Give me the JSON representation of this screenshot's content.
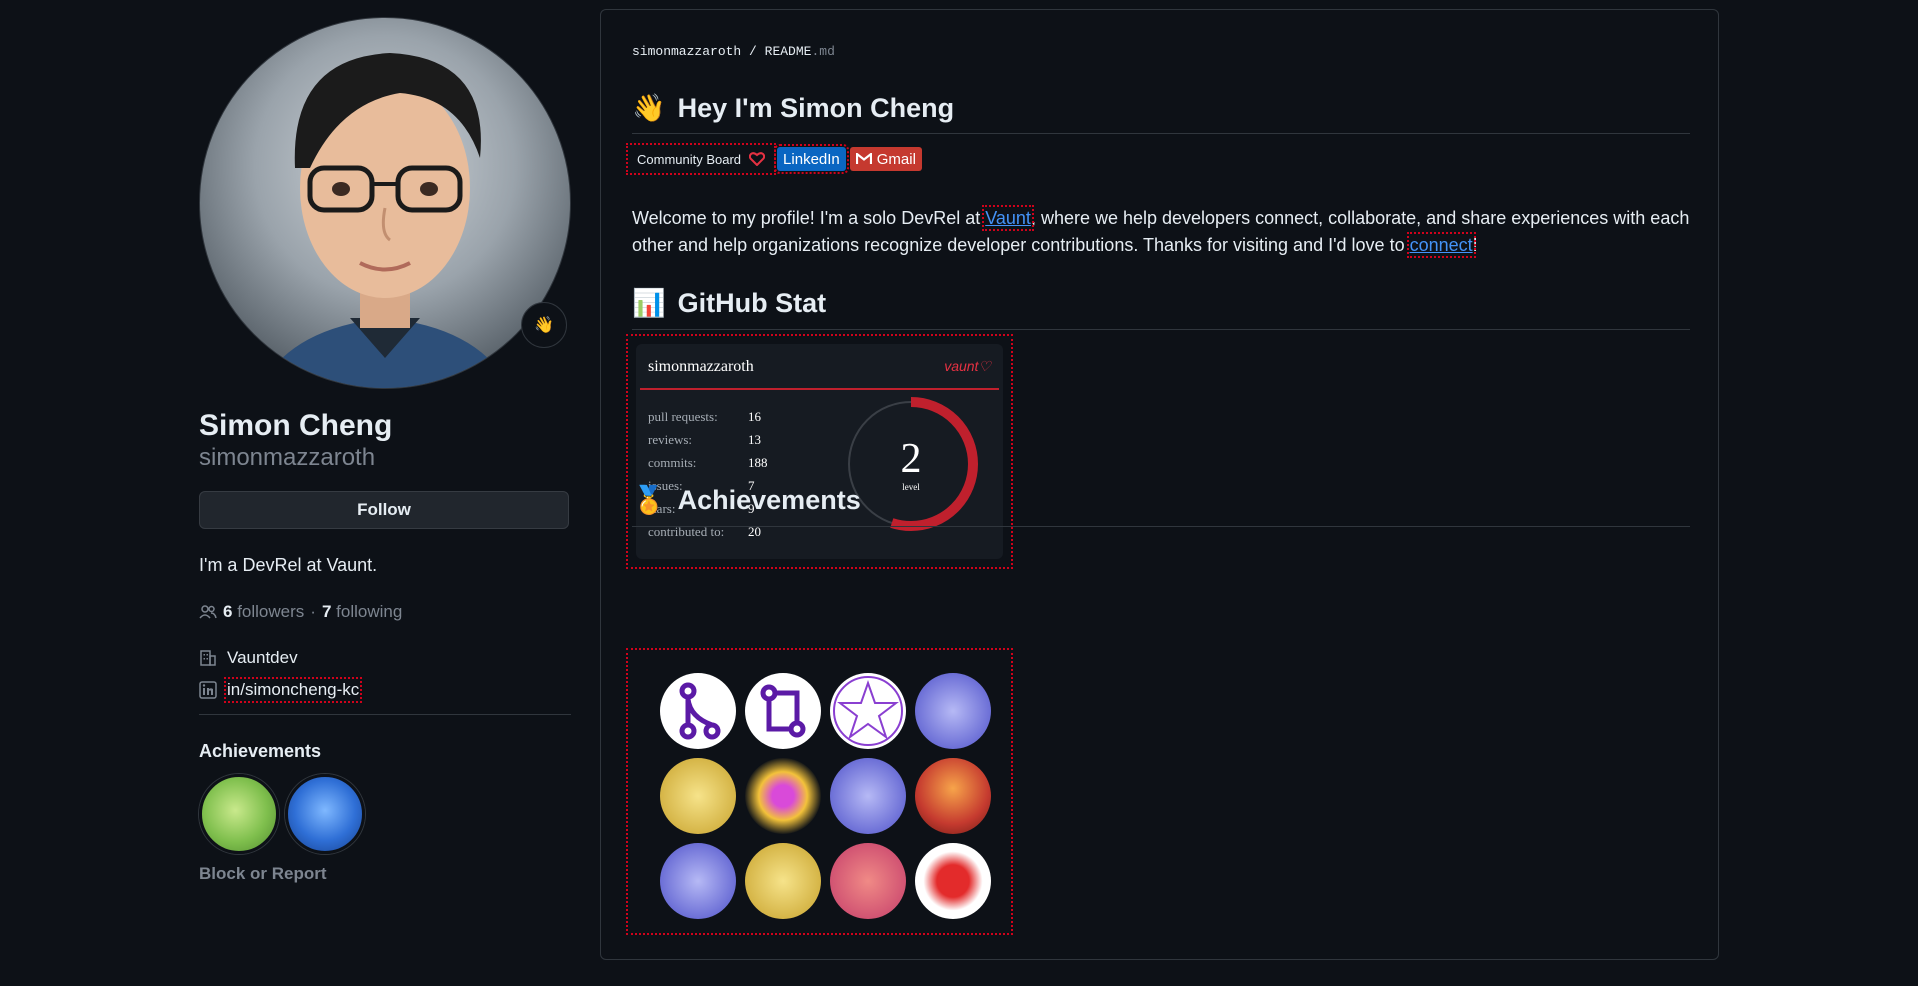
{
  "profile": {
    "name": "Simon Cheng",
    "login": "simonmazzaroth",
    "status_emoji": "👋",
    "follow_label": "Follow",
    "bio": "I'm a DevRel at Vaunt.",
    "followers_count": "6",
    "followers_label": "followers",
    "separator": "·",
    "following_count": "7",
    "following_label": "following",
    "organization": "Vauntdev",
    "linkedin": "in/simoncheng-kc",
    "achievements_title": "Achievements",
    "block_label": "Block or Report"
  },
  "readme": {
    "crumb_user": "simonmazzaroth",
    "crumb_sep": "/",
    "crumb_file": "README",
    "crumb_ext": ".md",
    "heading_main": "Hey I'm Simon Cheng",
    "heading_main_emoji": "👋",
    "community_board": "Community Board",
    "linkedin_badge": "LinkedIn",
    "gmail_badge": "Gmail",
    "intro_part1": "Welcome to my profile! I'm a solo DevRel at ",
    "intro_link1": "Vaunt",
    "intro_part2": ", where we help developers connect, collaborate, and share experiences with each other and help organizations recognize developer contributions. Thanks for visiting and I'd love to ",
    "intro_link2": "connect",
    "intro_part3": "!",
    "heading_stats": "GitHub Stat",
    "heading_stats_emoji": "📊",
    "heading_ach": "Achievements",
    "heading_ach_emoji": "🏅"
  },
  "stat_card": {
    "user": "simonmazzaroth",
    "brand": "vaunt♡",
    "rows": [
      {
        "k": "pull requests:",
        "v": "16"
      },
      {
        "k": "reviews:",
        "v": "13"
      },
      {
        "k": "commits:",
        "v": "188"
      },
      {
        "k": "issues:",
        "v": "7"
      },
      {
        "k": "stars:",
        "v": "9"
      },
      {
        "k": "contributed to:",
        "v": "20"
      }
    ],
    "level": "2",
    "level_label": "level",
    "level_progress": 0.55,
    "accent": "#c0202d"
  },
  "icons": {
    "status": "waving-hand-icon",
    "people": "people-icon",
    "org": "organization-icon",
    "linkedin": "linkedin-icon",
    "heart": "heart-icon",
    "gmail": "gmail-icon"
  }
}
